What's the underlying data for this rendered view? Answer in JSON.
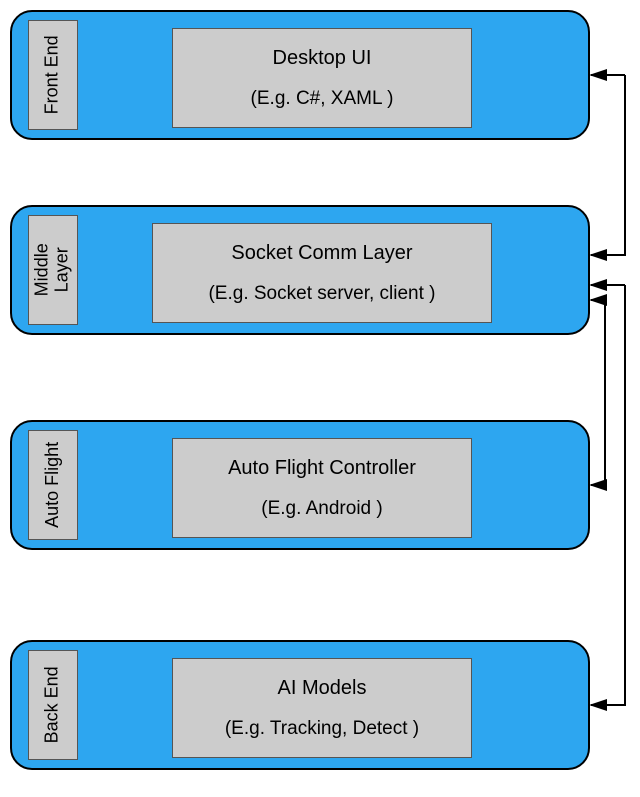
{
  "layers": {
    "frontend": {
      "side_label": "Front End",
      "title": "Desktop UI",
      "subtitle": "(E.g. C#, XAML )"
    },
    "middle": {
      "side_label": "Middle\nLayer",
      "title": "Socket Comm Layer",
      "subtitle": "(E.g. Socket server, client )"
    },
    "autoflight": {
      "side_label": "Auto Flight",
      "title": "Auto Flight Controller",
      "subtitle": "(E.g. Android )"
    },
    "backend": {
      "side_label": "Back End",
      "title": "AI Models",
      "subtitle": "(E.g. Tracking, Detect )"
    }
  },
  "colors": {
    "box_fill": "#2da6f0",
    "inner_fill": "#cccccc",
    "stroke": "#000000"
  }
}
